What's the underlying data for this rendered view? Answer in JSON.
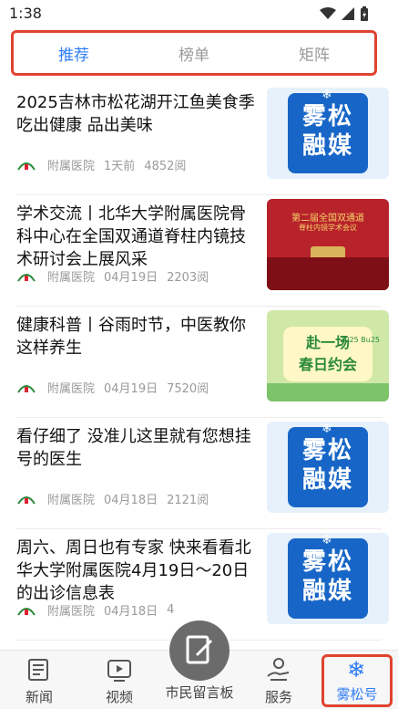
{
  "status_bar": {
    "time": "1:38"
  },
  "tabs": [
    {
      "label": "推荐",
      "active": true
    },
    {
      "label": "榜单",
      "active": false
    },
    {
      "label": "矩阵",
      "active": false
    }
  ],
  "feed": [
    {
      "title": "2025吉林市松花湖开江鱼美食季 吃出健康 品出美味",
      "source": "附属医院",
      "time": "1天前",
      "views": "4852阅",
      "thumb": "brand"
    },
    {
      "title": "学术交流丨北华大学附属医院骨科中心在全国双通道脊柱内镜技术研讨会上展风采",
      "source": "附属医院",
      "time": "04月19日",
      "views": "2203阅",
      "thumb": "conference"
    },
    {
      "title": "健康科普丨谷雨时节，中医教你这样养生",
      "source": "附属医院",
      "time": "04月19日",
      "views": "7520阅",
      "thumb": "spring"
    },
    {
      "title": "看仔细了 没准儿这里就有您想挂号的医生",
      "source": "附属医院",
      "time": "04月18日",
      "views": "2121阅",
      "thumb": "brand"
    },
    {
      "title": "周六、周日也有专家 快来看看北华大学附属医院4月19日～20日的出诊信息表",
      "source": "附属医院",
      "time": "04月18日",
      "views": "4",
      "thumb": "brand"
    }
  ],
  "thumbs": {
    "brand_line1": "雾松",
    "brand_line2": "融媒",
    "conference_title": "第二届全国双通道",
    "conference_sub": "脊柱内镜学术会议",
    "spring_line1": "赴一场",
    "spring_line2": "春日约会",
    "spring_sub": "2025 Bu25"
  },
  "bottom_nav": {
    "news": "新闻",
    "video": "视频",
    "message_board": "市民留言板",
    "service": "服务",
    "wusong": "雾松号"
  },
  "colors": {
    "accent": "#2e7cf6",
    "highlight_border": "#e0432f",
    "brand_blue": "#1766c7"
  }
}
